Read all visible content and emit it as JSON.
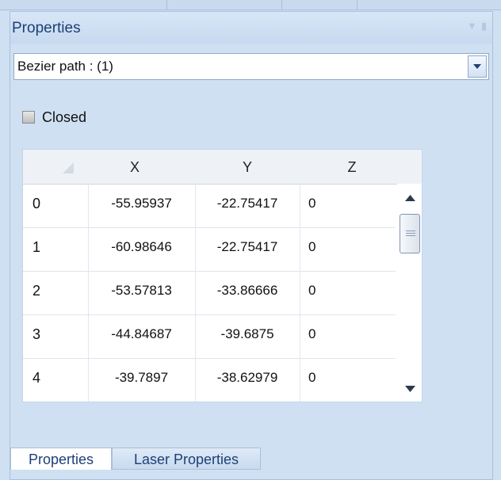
{
  "panel": {
    "title": "Properties"
  },
  "selector": {
    "value": "Bezier path : (1)"
  },
  "closed": {
    "label": "Closed",
    "checked": true
  },
  "grid": {
    "columns": [
      "X",
      "Y",
      "Z"
    ],
    "rows": [
      {
        "index": "0",
        "x": "-55.95937",
        "y": "-22.75417",
        "z": "0"
      },
      {
        "index": "1",
        "x": "-60.98646",
        "y": "-22.75417",
        "z": "0"
      },
      {
        "index": "2",
        "x": "-53.57813",
        "y": "-33.86666",
        "z": "0"
      },
      {
        "index": "3",
        "x": "-44.84687",
        "y": "-39.6875",
        "z": "0"
      },
      {
        "index": "4",
        "x": "-39.7897",
        "y": "-38.62979",
        "z": "0"
      }
    ]
  },
  "tabs": [
    {
      "label": "Properties",
      "active": true
    },
    {
      "label": "Laser Properties",
      "active": false
    }
  ],
  "icons": {
    "dropdown": "chevron-down-icon",
    "scroll_up": "arrow-up-icon",
    "scroll_down": "arrow-down-icon",
    "pin": "pin-icon"
  }
}
